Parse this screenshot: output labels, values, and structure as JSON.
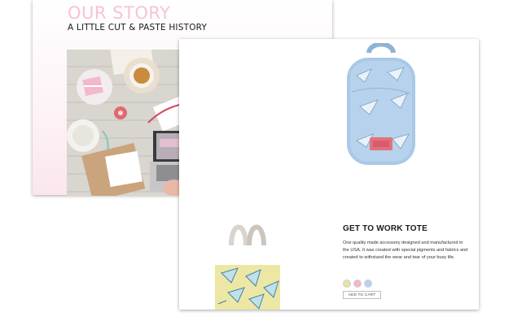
{
  "story": {
    "title": "OUR STORY",
    "subtitle": "A LITTLE CUT & PASTE HISTORY",
    "photo_icon": "crafting-desk-photo"
  },
  "product": {
    "name": "GET TO WORK TOTE",
    "description": "One quality made accessory designed and manufactured in the USA. It was created with special pigments and fabrics and created to withstand the wear and tear of your busy life.",
    "add_to_cart_label": "ADD TO CART",
    "swatches": [
      {
        "name": "yellow-pattern",
        "color": "#e8e2a6"
      },
      {
        "name": "pink-pattern",
        "color": "#f2b6c6"
      },
      {
        "name": "blue-pattern",
        "color": "#b7d3ef"
      }
    ],
    "images": [
      "backpack-image",
      "tote-bag-image"
    ]
  },
  "colors": {
    "title_pink": "#f6c4d4",
    "backpack_blue": "#a9c9e6",
    "tote_yellow": "#ece7a4"
  }
}
